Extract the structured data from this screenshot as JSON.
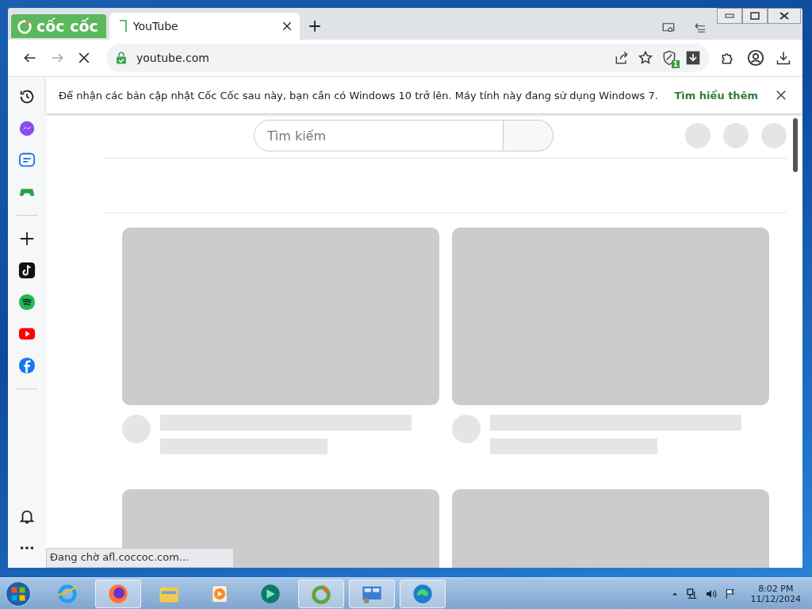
{
  "brand": "cốc cốc",
  "tabs": [
    {
      "label": "YouTube",
      "selected": true
    }
  ],
  "toolbar": {
    "loading": true,
    "address": "youtube.com",
    "shield_badge": "1"
  },
  "sidebar": {
    "items": [
      {
        "kind": "history"
      },
      {
        "kind": "messenger"
      },
      {
        "kind": "zalo"
      },
      {
        "kind": "games"
      },
      {
        "kind": "divider"
      },
      {
        "kind": "add"
      },
      {
        "kind": "tiktok"
      },
      {
        "kind": "spotify"
      },
      {
        "kind": "youtube"
      },
      {
        "kind": "facebook"
      },
      {
        "kind": "divider"
      }
    ],
    "bottom": [
      {
        "kind": "bell"
      },
      {
        "kind": "more"
      }
    ]
  },
  "infobar": {
    "message": "Để nhận các bản cập nhật Cốc Cốc sau này, bạn cần có Windows 10 trở lên. Máy tính này đang sử dụng Windows 7.",
    "link": "Tìm hiểu thêm"
  },
  "search": {
    "placeholder": "Tìm kiếm"
  },
  "status": "Đang chờ afl.coccoc.com...",
  "taskbar": {
    "apps": [
      {
        "kind": "ie",
        "running": false
      },
      {
        "kind": "firefox",
        "running": true
      },
      {
        "kind": "explorer",
        "running": false
      },
      {
        "kind": "media",
        "running": false
      },
      {
        "kind": "app",
        "running": false
      },
      {
        "kind": "coccoc",
        "running": true
      },
      {
        "kind": "control",
        "running": true
      },
      {
        "kind": "edge",
        "running": true
      }
    ],
    "time": "8:02 PM",
    "date": "11/12/2024"
  }
}
